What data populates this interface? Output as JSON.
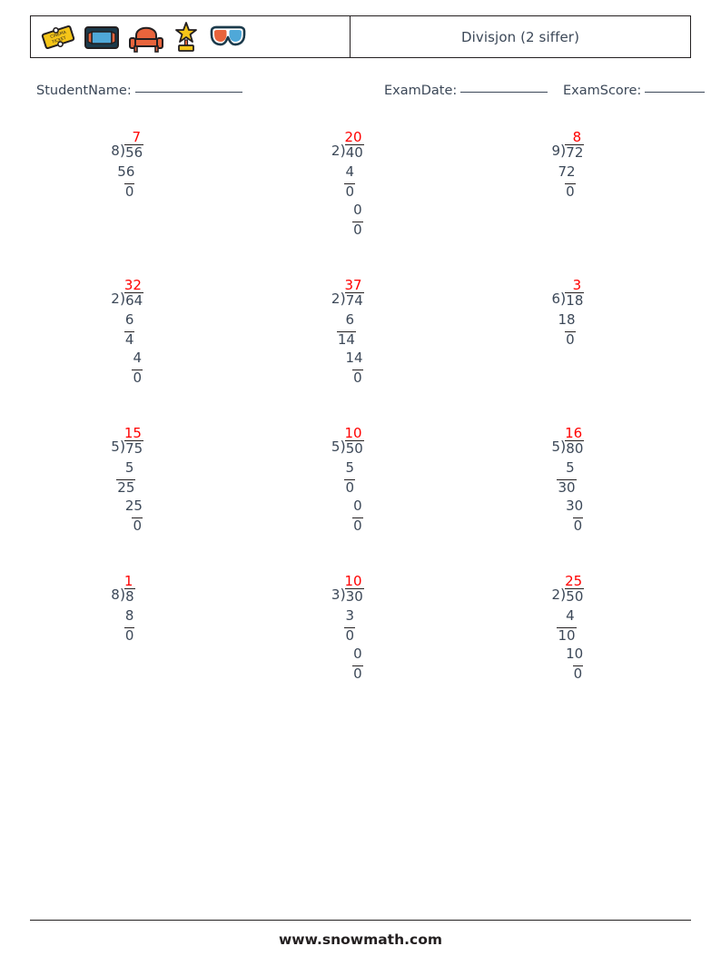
{
  "header": {
    "title": "Divisjon (2 siffer)",
    "icons": [
      {
        "name": "cinema-ticket-icon"
      },
      {
        "name": "vhs-tape-icon"
      },
      {
        "name": "theater-seat-icon"
      },
      {
        "name": "star-award-icon"
      },
      {
        "name": "3d-glasses-icon"
      }
    ]
  },
  "info": {
    "student_name_label": "StudentName:",
    "exam_date_label": "ExamDate:",
    "exam_score_label": "ExamScore:",
    "student_name_value": "",
    "exam_date_value": "",
    "exam_score_value": ""
  },
  "colors": {
    "quotient": "#ff0000",
    "numbers": "#3c4858",
    "rule": "#231f20"
  },
  "footer": {
    "url": "www.snowmath.com"
  },
  "problems": [
    {
      "id": 1,
      "divisor": "8",
      "dividend": "56",
      "quotient": "7",
      "steps": [
        {
          "value": "56",
          "ruled": false
        },
        {
          "value": "0",
          "ruled": true
        }
      ]
    },
    {
      "id": 2,
      "divisor": "2",
      "dividend": "40",
      "quotient": "20",
      "steps": [
        {
          "value": "4",
          "ruled": false
        },
        {
          "value": "0",
          "ruled": true
        },
        {
          "value": "0",
          "ruled": false
        },
        {
          "value": "0",
          "ruled": true
        }
      ]
    },
    {
      "id": 3,
      "divisor": "9",
      "dividend": "72",
      "quotient": "8",
      "steps": [
        {
          "value": "72",
          "ruled": false
        },
        {
          "value": "0",
          "ruled": true
        }
      ]
    },
    {
      "id": 4,
      "divisor": "2",
      "dividend": "64",
      "quotient": "32",
      "steps": [
        {
          "value": "6",
          "ruled": false
        },
        {
          "value": "4",
          "ruled": true
        },
        {
          "value": "4",
          "ruled": false
        },
        {
          "value": "0",
          "ruled": true
        }
      ]
    },
    {
      "id": 5,
      "divisor": "2",
      "dividend": "74",
      "quotient": "37",
      "steps": [
        {
          "value": "6",
          "ruled": false
        },
        {
          "value": "14",
          "ruled": true
        },
        {
          "value": "14",
          "ruled": false
        },
        {
          "value": "0",
          "ruled": true
        }
      ]
    },
    {
      "id": 6,
      "divisor": "6",
      "dividend": "18",
      "quotient": "3",
      "steps": [
        {
          "value": "18",
          "ruled": false
        },
        {
          "value": "0",
          "ruled": true
        }
      ]
    },
    {
      "id": 7,
      "divisor": "5",
      "dividend": "75",
      "quotient": "15",
      "steps": [
        {
          "value": "5",
          "ruled": false
        },
        {
          "value": "25",
          "ruled": true
        },
        {
          "value": "25",
          "ruled": false
        },
        {
          "value": "0",
          "ruled": true
        }
      ]
    },
    {
      "id": 8,
      "divisor": "5",
      "dividend": "50",
      "quotient": "10",
      "steps": [
        {
          "value": "5",
          "ruled": false
        },
        {
          "value": "0",
          "ruled": true
        },
        {
          "value": "0",
          "ruled": false
        },
        {
          "value": "0",
          "ruled": true
        }
      ]
    },
    {
      "id": 9,
      "divisor": "5",
      "dividend": "80",
      "quotient": "16",
      "steps": [
        {
          "value": "5",
          "ruled": false
        },
        {
          "value": "30",
          "ruled": true
        },
        {
          "value": "30",
          "ruled": false
        },
        {
          "value": "0",
          "ruled": true
        }
      ]
    },
    {
      "id": 10,
      "divisor": "8",
      "dividend": "8",
      "quotient": "1",
      "steps": [
        {
          "value": "8",
          "ruled": false
        },
        {
          "value": "0",
          "ruled": true
        }
      ]
    },
    {
      "id": 11,
      "divisor": "3",
      "dividend": "30",
      "quotient": "10",
      "steps": [
        {
          "value": "3",
          "ruled": false
        },
        {
          "value": "0",
          "ruled": true
        },
        {
          "value": "0",
          "ruled": false
        },
        {
          "value": "0",
          "ruled": true
        }
      ]
    },
    {
      "id": 12,
      "divisor": "2",
      "dividend": "50",
      "quotient": "25",
      "steps": [
        {
          "value": "4",
          "ruled": false
        },
        {
          "value": "10",
          "ruled": true
        },
        {
          "value": "10",
          "ruled": false
        },
        {
          "value": "0",
          "ruled": true
        }
      ]
    }
  ]
}
